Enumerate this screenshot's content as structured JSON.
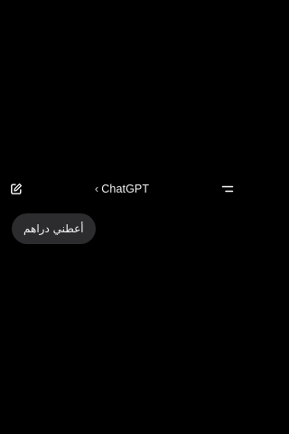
{
  "header": {
    "title": "ChatGPT",
    "back_glyph": "‹",
    "left_icon": "new-chat-icon",
    "right_icon": "menu-icon"
  },
  "messages": [
    {
      "role": "user",
      "text": "أعطني دراهم"
    }
  ],
  "colors": {
    "background": "#000000",
    "bubble": "#2c2c2e",
    "text": "#ffffff"
  }
}
